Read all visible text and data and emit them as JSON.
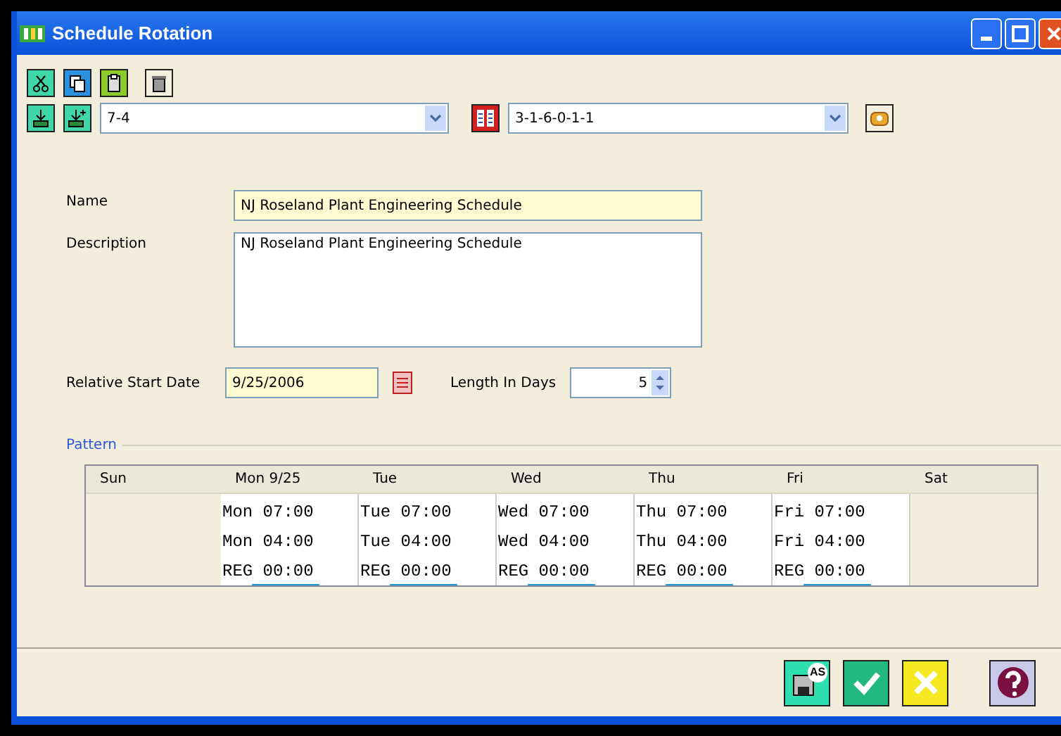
{
  "window": {
    "title": "Schedule Rotation"
  },
  "toolbar": {
    "rotation_combo": {
      "value": "7-4"
    },
    "pattern_combo": {
      "value": "3-1-6-0-1-1"
    }
  },
  "form": {
    "name": {
      "label": "Name",
      "value": "NJ Roseland Plant Engineering Schedule"
    },
    "description": {
      "label": "Description",
      "value": "NJ Roseland Plant Engineering Schedule"
    },
    "start_date": {
      "label": "Relative Start Date",
      "value": "9/25/2006"
    },
    "length": {
      "label": "Length In Days",
      "value": "5"
    }
  },
  "pattern": {
    "title": "Pattern",
    "columns": [
      {
        "header": "Sun"
      },
      {
        "header": "Mon 9/25",
        "entries": [
          "Mon 07:00",
          "Mon 04:00",
          "REG 00:00"
        ]
      },
      {
        "header": "Tue",
        "entries": [
          "Tue 07:00",
          "Tue 04:00",
          "REG 00:00"
        ]
      },
      {
        "header": "Wed",
        "entries": [
          "Wed 07:00",
          "Wed 04:00",
          "REG 00:00"
        ]
      },
      {
        "header": "Thu",
        "entries": [
          "Thu 07:00",
          "Thu 04:00",
          "REG 00:00"
        ]
      },
      {
        "header": "Fri",
        "entries": [
          "Fri 07:00",
          "Fri 04:00",
          "REG 00:00"
        ]
      },
      {
        "header": "Sat"
      }
    ]
  },
  "footer": {
    "save_as_badge": "AS"
  }
}
